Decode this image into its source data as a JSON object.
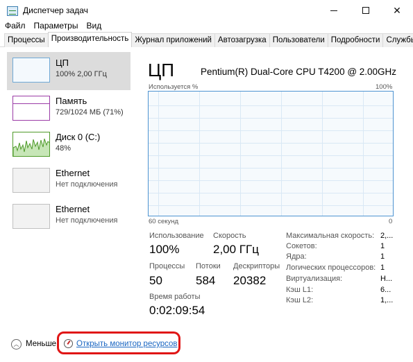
{
  "window": {
    "title": "Диспетчер задач",
    "minimize_glyph": "",
    "maximize_glyph": "",
    "close_glyph": "✕"
  },
  "menu": [
    "Файл",
    "Параметры",
    "Вид"
  ],
  "tabs": [
    {
      "label": "Процессы",
      "active": false
    },
    {
      "label": "Производительность",
      "active": true
    },
    {
      "label": "Журнал приложений",
      "active": false
    },
    {
      "label": "Автозагрузка",
      "active": false
    },
    {
      "label": "Пользователи",
      "active": false
    },
    {
      "label": "Подробности",
      "active": false
    },
    {
      "label": "Службы",
      "active": false
    }
  ],
  "sidebar": {
    "items": [
      {
        "name": "ЦП",
        "sub": "100% 2,00 ГГц",
        "selected": true
      },
      {
        "name": "Память",
        "sub": "729/1024 МБ (71%)"
      },
      {
        "name": "Диск 0 (C:)",
        "sub": "48%"
      },
      {
        "name": "Ethernet",
        "sub": "Нет подключения"
      },
      {
        "name": "Ethernet",
        "sub": "Нет подключения"
      }
    ]
  },
  "main": {
    "title": "ЦП",
    "cpu_model": "Pentium(R) Dual-Core CPU T4200 @ 2.00GHz",
    "graph_label": "Используется %",
    "graph_max": "100%",
    "time_left": "60 секунд",
    "time_right": "0",
    "stats": {
      "usage_label": "Использование",
      "usage_value": "100%",
      "speed_label": "Скорость",
      "speed_value": "2,00 ГГц",
      "processes_label": "Процессы",
      "processes_value": "50",
      "threads_label": "Потоки",
      "threads_value": "584",
      "handles_label": "Дескрипторы",
      "handles_value": "20382",
      "uptime_label": "Время работы",
      "uptime_value": "0:02:09:54"
    },
    "details": [
      {
        "label": "Максимальная скорость:",
        "value": "2,..."
      },
      {
        "label": "Сокетов:",
        "value": "1"
      },
      {
        "label": "Ядра:",
        "value": "1"
      },
      {
        "label": "Логических процессоров:",
        "value": "1"
      },
      {
        "label": "Виртуализация:",
        "value": "Н..."
      },
      {
        "label": "Кэш L1:",
        "value": "6..."
      },
      {
        "label": "Кэш L2:",
        "value": "1,..."
      }
    ]
  },
  "footer": {
    "fewer_label": "Меньше",
    "fewer_glyph": "︿",
    "monitor_link": "Открыть монитор ресурсов"
  },
  "colors": {
    "cpu_graph_border": "#4d93d1",
    "memory": "#9b3ba6",
    "disk": "#4e9a29",
    "link": "#1a66c2",
    "highlight": "#e01515"
  }
}
